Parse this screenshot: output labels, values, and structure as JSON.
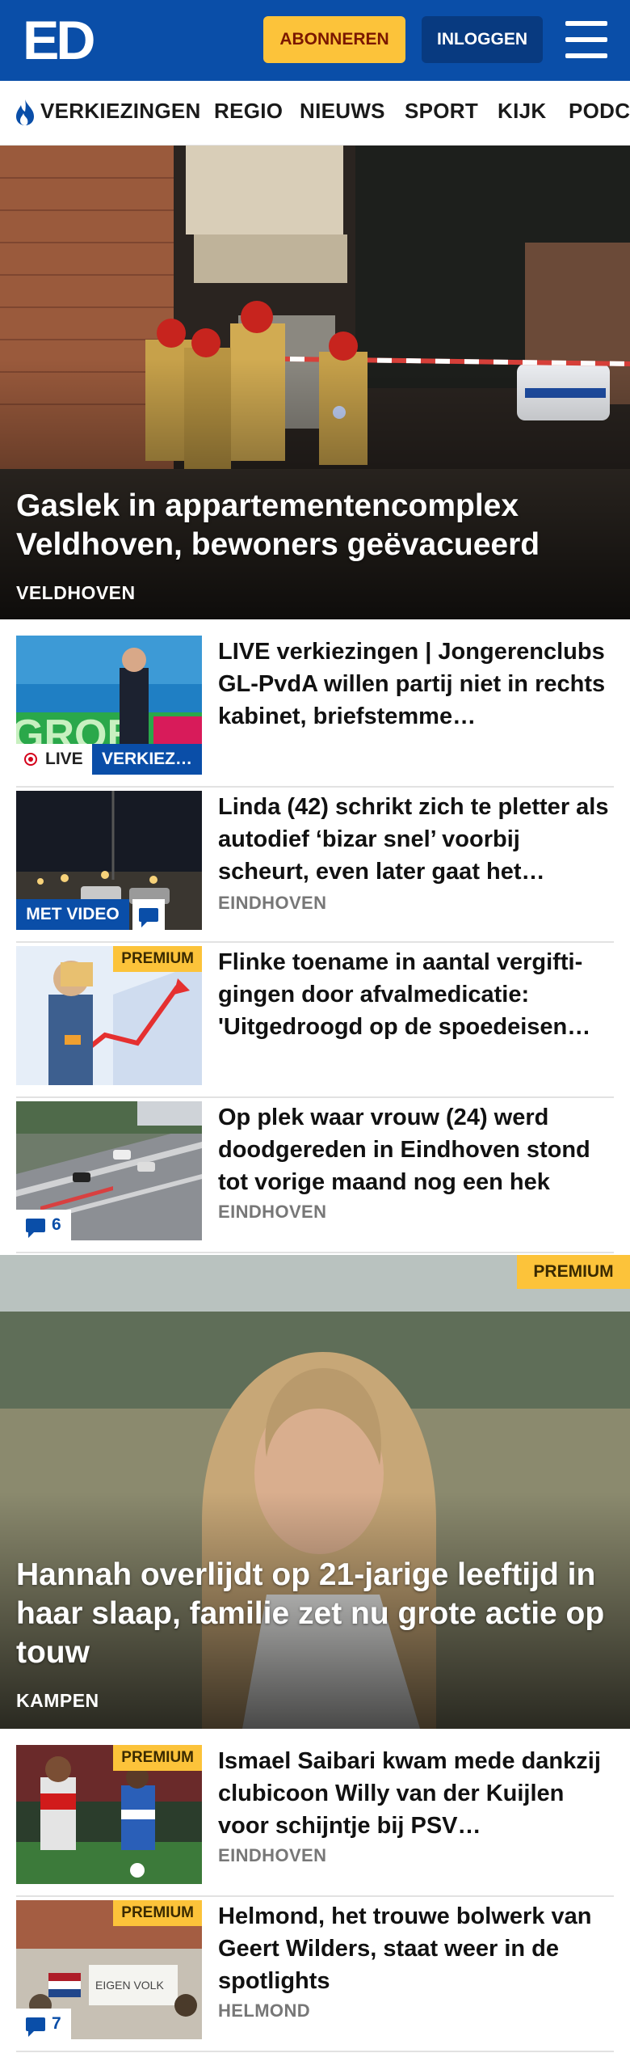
{
  "header": {
    "logo": "ED",
    "subscribe_label": "ABONNEREN",
    "login_label": "INLOGGEN"
  },
  "nav": {
    "items": [
      "VERKIEZINGEN",
      "REGIO",
      "NIEUWS",
      "SPORT",
      "KIJK",
      "PODC"
    ]
  },
  "hero": {
    "title": "Gaslek in appartementencomplex Veldhoven, bewoners geëvacueerd",
    "tag": "VELDHOVEN"
  },
  "articles": [
    {
      "title": "LIVE verkiezingen | Jongeren­clubs GL-PvdA willen partij niet in rechts kabinet, briefstemme…",
      "live_label": "LIVE",
      "category_label": "VERKIEZ…"
    },
    {
      "title": "Linda (42) schrikt zich te pletter als autodief ‘bizar snel’ voorbij scheurt, even later gaat het…",
      "tag": "EINDHOVEN",
      "video_label": "MET VIDEO"
    },
    {
      "title": "Flinke toename in aantal vergifti­gingen door afvalmedicatie: 'Uitgedroogd op de spoedeisen…",
      "premium_label": "PREMIUM"
    },
    {
      "title": "Op plek waar vrouw (24) werd doodgereden in Eindhoven stond tot vorige maand nog een hek",
      "tag": "EINDHOVEN",
      "comment_count": "6"
    }
  ],
  "feature": {
    "title": "Hannah overlijdt op 21-jarige leeftijd in haar slaap, familie zet nu grote actie op touw",
    "tag": "KAMPEN",
    "premium_label": "PREMIUM"
  },
  "articles2": [
    {
      "title": "Ismael Saibari kwam mede dankzij clubicoon Willy van der Kuijlen voor schijntje bij PSV…",
      "tag": "EINDHOVEN",
      "premium_label": "PREMIUM"
    },
    {
      "title": "Helmond, het trouwe bolwerk van Geert Wilders, staat weer in de spotlights",
      "tag": "HELMOND",
      "premium_label": "PREMIUM",
      "comment_count": "7"
    }
  ],
  "colors": {
    "brand_blue": "#0a4ea8",
    "subscribe_yellow": "#fcc33a",
    "tag_grey": "#777777"
  }
}
